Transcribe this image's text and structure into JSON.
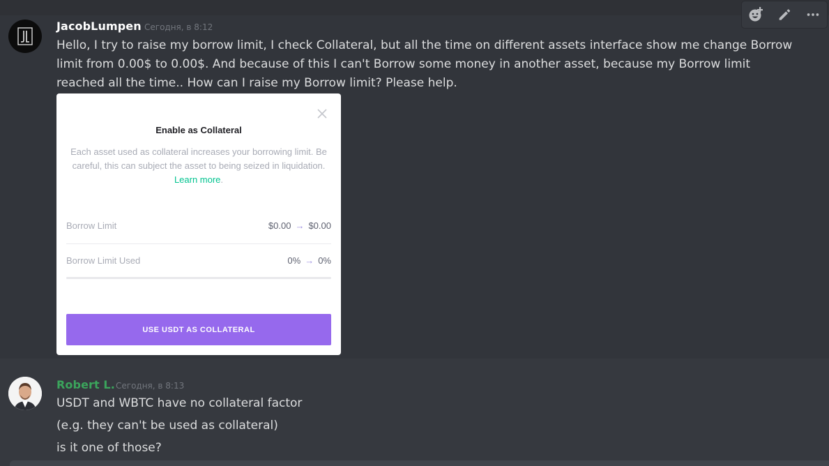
{
  "toolbar": {
    "icons": [
      "add-reaction-icon",
      "edit-icon",
      "more-icon"
    ]
  },
  "messages": [
    {
      "author": "JacobLumpen",
      "author_color": "#ffffff",
      "avatar_text": "JL",
      "timestamp": "Сегодня, в 8:12",
      "text": "Hello, I try to raise my borrow limit, I check Collateral, but all the time on different assets interface show me  change Borrow limit from 0.00$ to 0.00$. And because of this I can't Borrow some money in another asset, because my Borrow limit reached all the time.. How can I raise my Borrow limit? Please help."
    },
    {
      "author": "Robert L.",
      "author_color": "#3ba55c",
      "timestamp": "Сегодня, в 8:13",
      "lines": [
        "USDT and WBTC have no collateral factor",
        "(e.g. they can't be used as collateral)",
        "is it one of those?"
      ]
    }
  ],
  "modal": {
    "title": "Enable as Collateral",
    "description": "Each asset used as collateral increases your borrowing limit. Be careful, this can subject the asset to being seized in liquidation.",
    "learn_more": "Learn more",
    "rows": [
      {
        "label": "Borrow Limit",
        "from": "$0.00",
        "arrow": "→",
        "to": "$0.00"
      },
      {
        "label": "Borrow Limit Used",
        "from": "0%",
        "arrow": "→",
        "to": "0%"
      }
    ],
    "borrow_limit_used_fraction": 0.0,
    "button": "USE USDT AS COLLATERAL",
    "accent_color": "#9669ed",
    "link_color": "#00c38f"
  }
}
